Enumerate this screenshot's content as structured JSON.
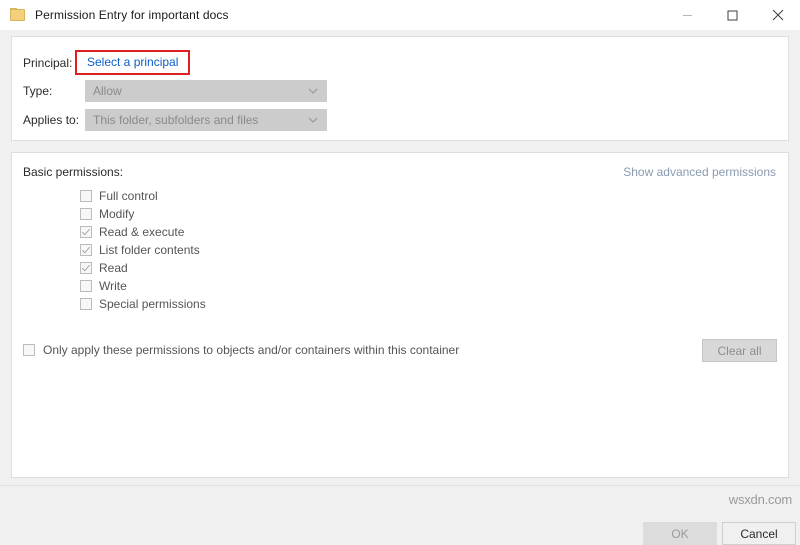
{
  "window": {
    "title": "Permission Entry for important docs",
    "icon": "folder-icon",
    "controls": {
      "minimize": "minimize-icon",
      "maximize": "maximize-icon",
      "close": "close-icon"
    }
  },
  "principal_panel": {
    "principal_label": "Principal:",
    "principal_link": "Select a principal",
    "principal_highlight_color": "#e02020",
    "type_label": "Type:",
    "type_value": "Allow",
    "applies_to_label": "Applies to:",
    "applies_to_value": "This folder, subfolders and files"
  },
  "permissions_panel": {
    "section_title": "Basic permissions:",
    "advanced_link": "Show advanced permissions",
    "items": [
      {
        "label": "Full control",
        "checked": false
      },
      {
        "label": "Modify",
        "checked": false
      },
      {
        "label": "Read & execute",
        "checked": true
      },
      {
        "label": "List folder contents",
        "checked": true
      },
      {
        "label": "Read",
        "checked": true
      },
      {
        "label": "Write",
        "checked": false
      },
      {
        "label": "Special permissions",
        "checked": false
      }
    ],
    "only_apply_label": "Only apply these permissions to objects and/or containers within this container",
    "only_apply_checked": false,
    "clear_all_label": "Clear all"
  },
  "footer": {
    "ok_label": "OK",
    "cancel_label": "Cancel"
  },
  "watermark": {
    "text": "wsxdn.com"
  },
  "colors": {
    "link_blue": "#0b5ec7",
    "highlight_red": "#e02020",
    "window_bg": "#f0f0f0",
    "panel_bg": "#ffffff"
  }
}
